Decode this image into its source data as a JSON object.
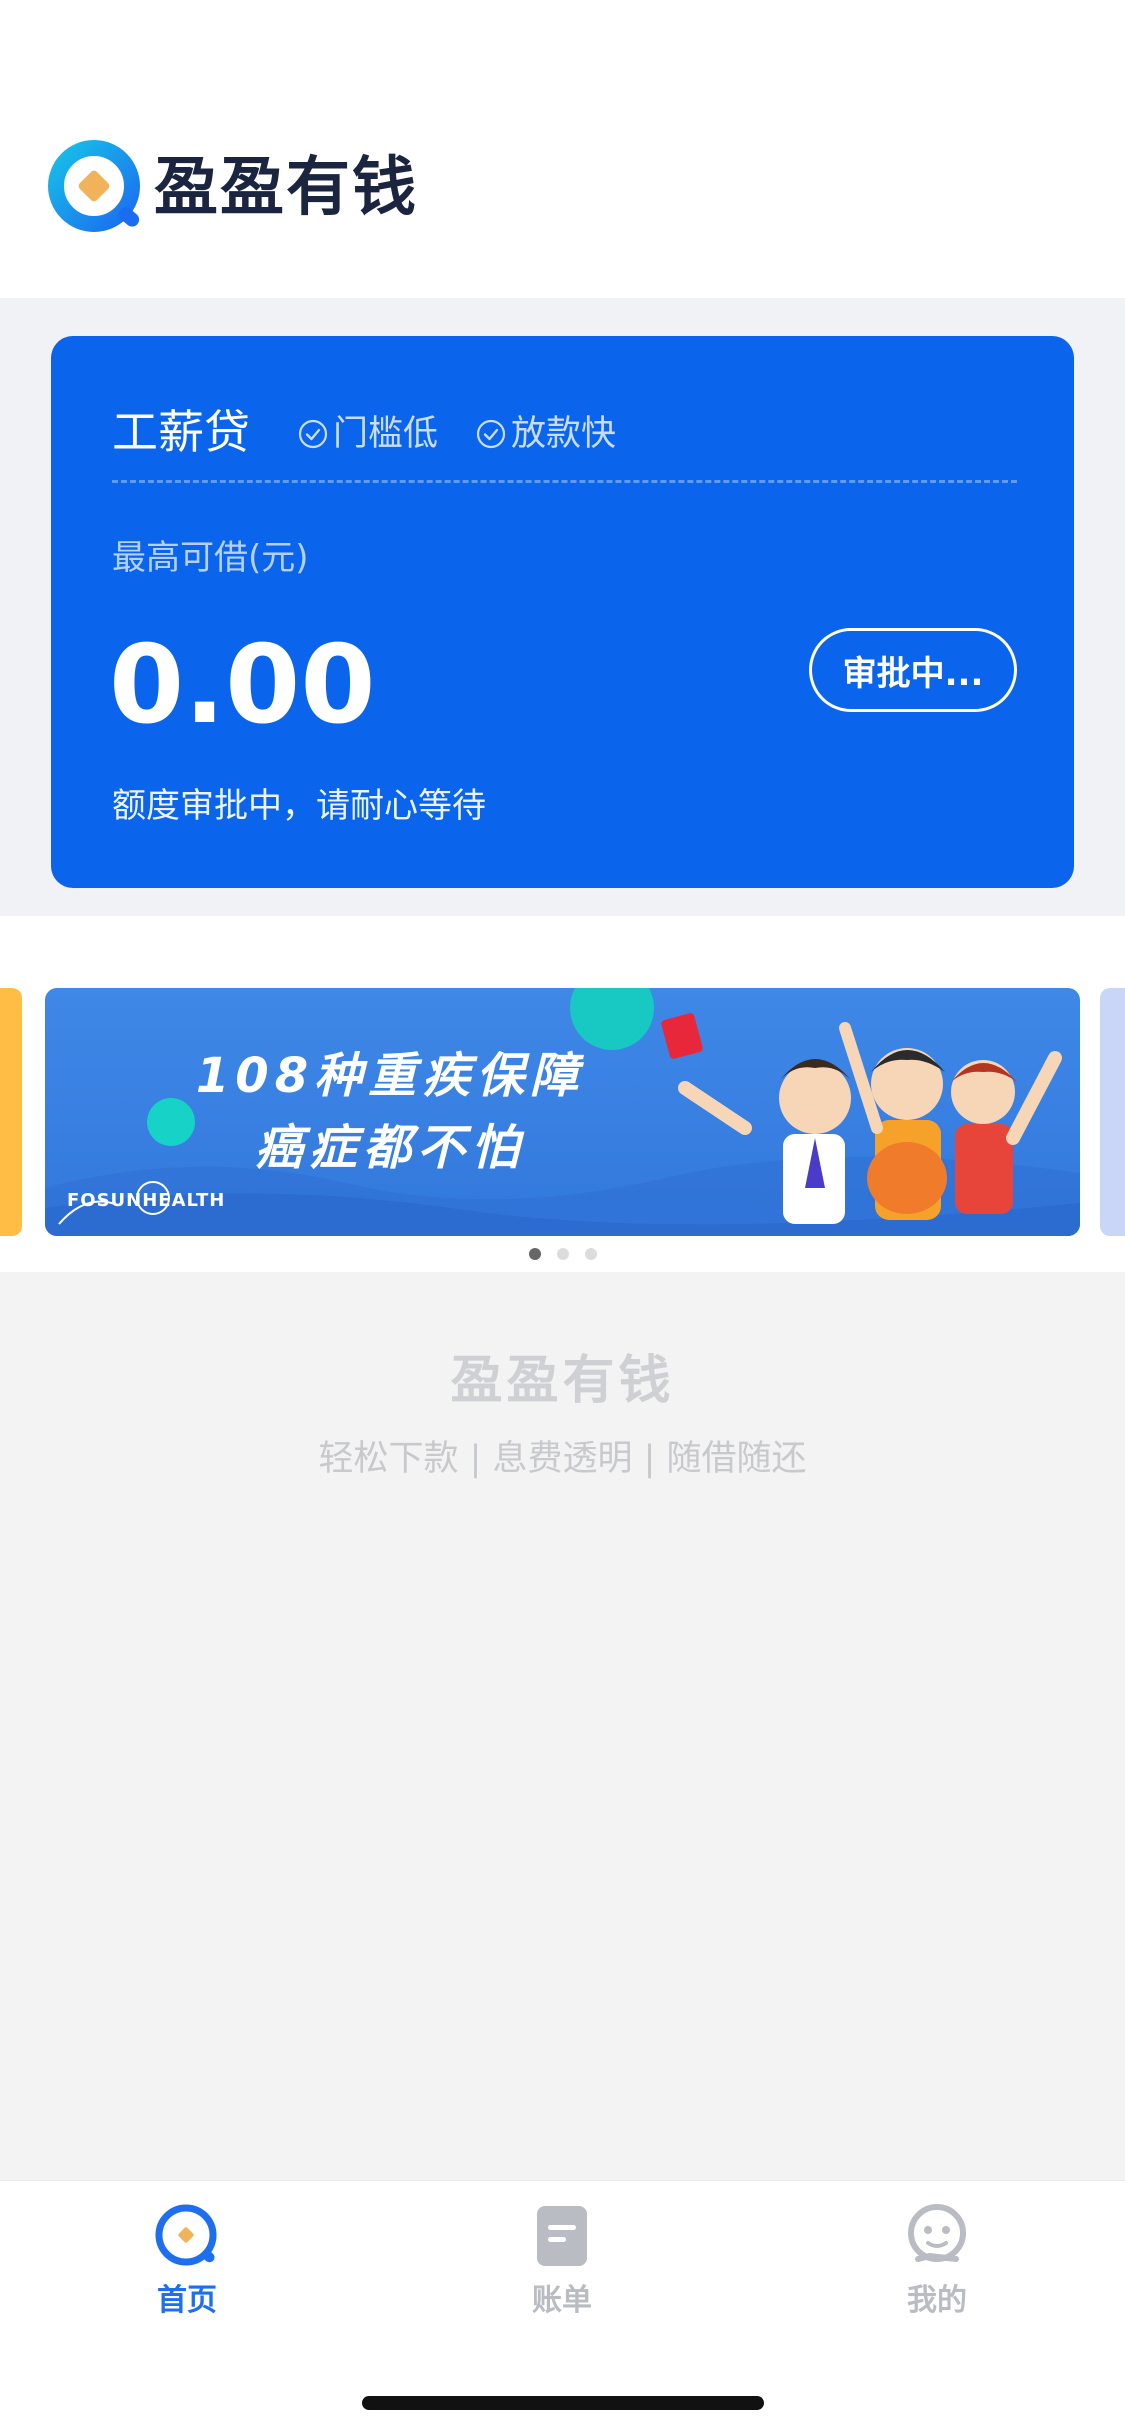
{
  "app": {
    "name": "盈盈有钱"
  },
  "loan_card": {
    "product_name": "工薪贷",
    "tags": [
      "门槛低",
      "放款快"
    ],
    "limit_label": "最高可借(元)",
    "amount": "0.00",
    "status_button": "审批中...",
    "status_note": "额度审批中，请耐心等待"
  },
  "banner": {
    "line1": "108种重疾保障",
    "line2": "癌症都不怕",
    "brand": "FOSUNHEALTH",
    "page_count": 3,
    "active_index": 0
  },
  "footer": {
    "brand": "盈盈有钱",
    "slogan": "轻松下款 | 息费透明 | 随借随还"
  },
  "tabbar": {
    "items": [
      {
        "label": "首页",
        "icon": "home-icon",
        "active": true
      },
      {
        "label": "账单",
        "icon": "bill-icon",
        "active": false
      },
      {
        "label": "我的",
        "icon": "profile-icon",
        "active": false
      }
    ]
  },
  "colors": {
    "primary": "#0a64ec",
    "active_tab": "#1e6ef0",
    "inactive_tab": "#b9bcc2",
    "logo_accent": "#f0b35a"
  }
}
